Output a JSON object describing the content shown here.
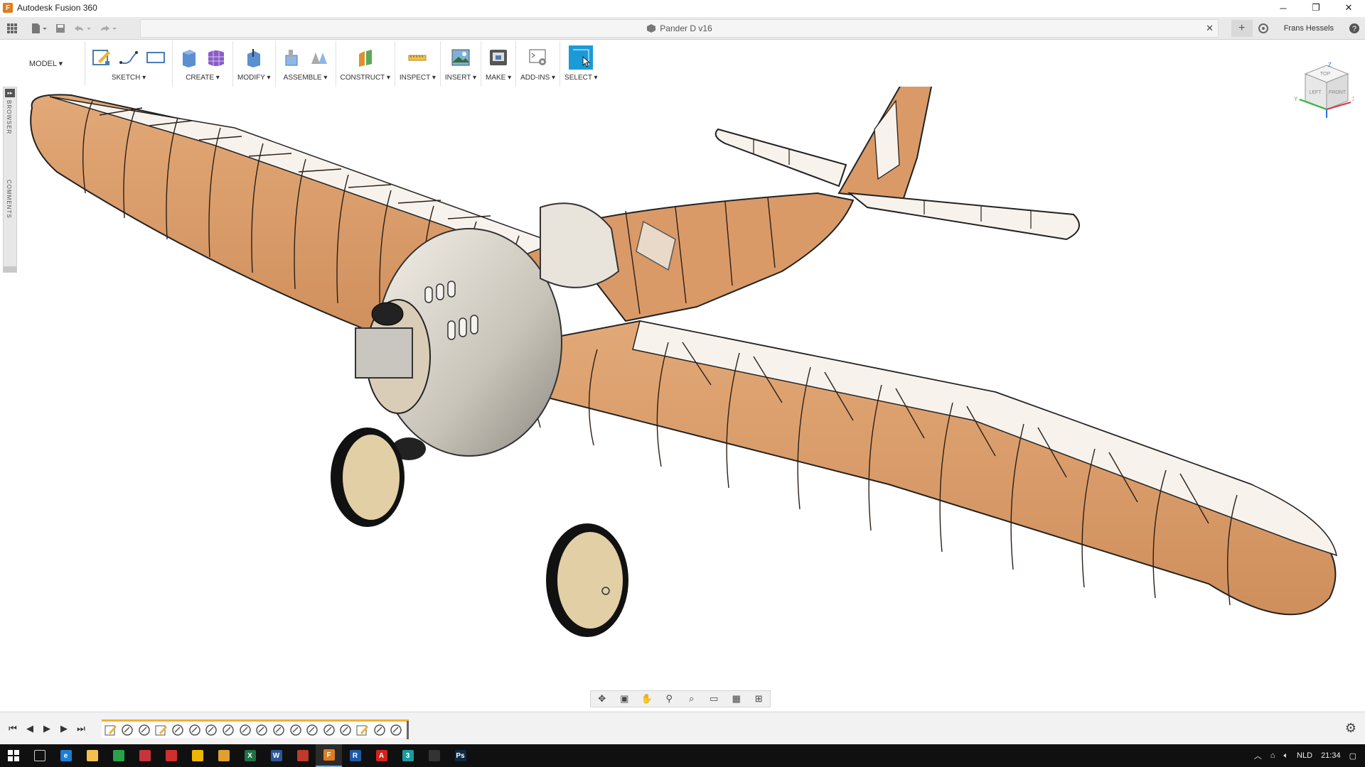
{
  "app": {
    "title": "Autodesk Fusion 360",
    "logo_letter": "F"
  },
  "window_controls": {
    "minimize": "─",
    "restore": "❐",
    "close": "✕"
  },
  "document": {
    "tab_title": "Pander D v16",
    "close_glyph": "✕",
    "user": "Frans Hessels"
  },
  "ribbon": {
    "workspace": "MODEL ▾",
    "groups": [
      {
        "label": "SKETCH ▾"
      },
      {
        "label": "CREATE ▾"
      },
      {
        "label": "MODIFY ▾"
      },
      {
        "label": "ASSEMBLE ▾"
      },
      {
        "label": "CONSTRUCT ▾"
      },
      {
        "label": "INSPECT ▾"
      },
      {
        "label": "INSERT ▾"
      },
      {
        "label": "MAKE ▾"
      },
      {
        "label": "ADD-INS ▾"
      },
      {
        "label": "SELECT ▾"
      }
    ]
  },
  "side_panel": {
    "expand": "▸▸",
    "browser": "BROWSER",
    "comments": "COMMENTS"
  },
  "viewcube": {
    "top": "TOP",
    "left": "LEFT",
    "front": "FRONT",
    "x": "X",
    "y": "Y",
    "z": "Z"
  },
  "model": {
    "name": "Pander D v16",
    "color": "#d99a68"
  },
  "timeline": {
    "item_count": 18,
    "settings_icon": "⚙"
  },
  "taskbar": {
    "language": "NLD",
    "clock": "21:34",
    "apps": [
      {
        "name": "task-view",
        "label": ""
      },
      {
        "name": "edge",
        "label": "e",
        "color": "#1a7fd4"
      },
      {
        "name": "file-explorer",
        "label": "",
        "color": "#f3c14b"
      },
      {
        "name": "app-green",
        "label": "",
        "color": "#27a34a"
      },
      {
        "name": "app-red",
        "label": "",
        "color": "#c8343a"
      },
      {
        "name": "app-red2",
        "label": "",
        "color": "#d12e2e"
      },
      {
        "name": "app-yellow",
        "label": "",
        "color": "#f0b700"
      },
      {
        "name": "chrome",
        "label": "",
        "color": "#e0a030"
      },
      {
        "name": "excel",
        "label": "X",
        "color": "#1e7145"
      },
      {
        "name": "word",
        "label": "W",
        "color": "#2b579a"
      },
      {
        "name": "app-red3",
        "label": "",
        "color": "#c0392b"
      },
      {
        "name": "fusion360",
        "label": "F",
        "color": "#e07b1e"
      },
      {
        "name": "revit",
        "label": "R",
        "color": "#1f5aa6"
      },
      {
        "name": "acrobat",
        "label": "A",
        "color": "#d4231a"
      },
      {
        "name": "app-teal",
        "label": "3",
        "color": "#1a9ba0"
      },
      {
        "name": "app-dark",
        "label": "",
        "color": "#333333"
      },
      {
        "name": "photoshop",
        "label": "Ps",
        "color": "#0d2a44"
      }
    ]
  }
}
